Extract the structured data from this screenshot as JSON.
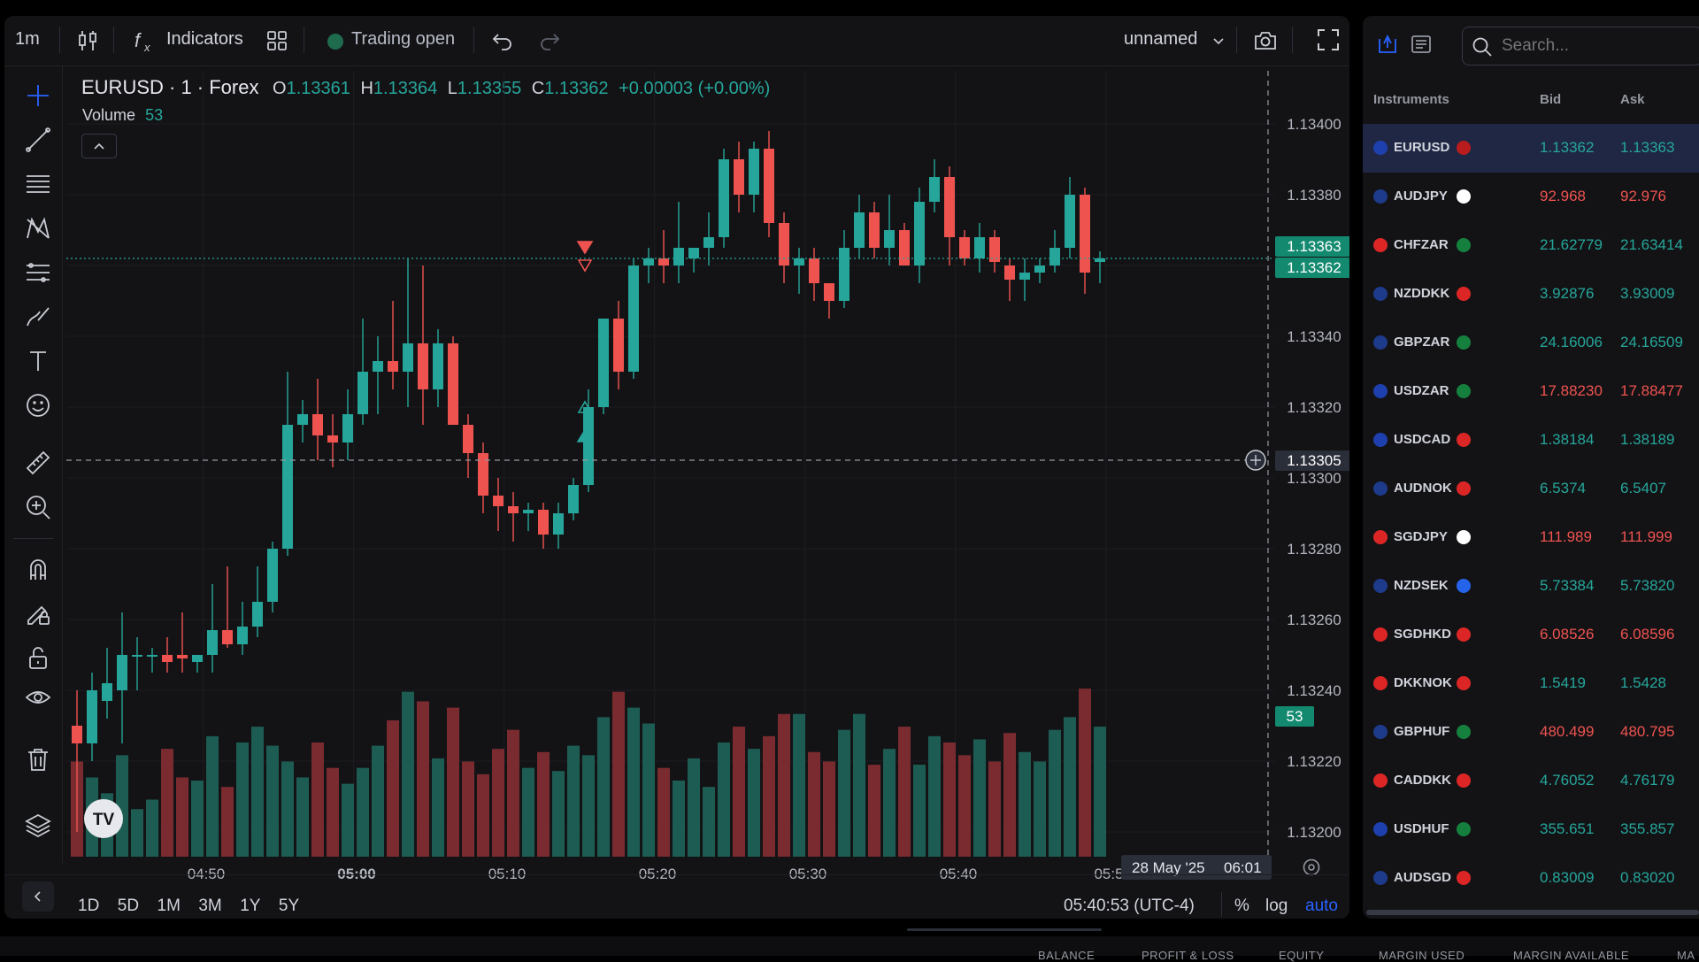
{
  "toolbar": {
    "interval": "1m",
    "indicators_label": "Indicators",
    "trading_status": "Trading open",
    "layout_name": "unnamed"
  },
  "legend": {
    "symbol": "EURUSD · 1 · Forex",
    "o_label": "O",
    "open": "1.13361",
    "h_label": "H",
    "high": "1.13364",
    "l_label": "L",
    "low": "1.13355",
    "c_label": "C",
    "close": "1.13362",
    "change": "+0.00003 (+0.00%)",
    "volume_label": "Volume",
    "volume_value": "53"
  },
  "price_axis": {
    "ticks": [
      "1.13400",
      "1.13380",
      "1.13340",
      "1.13320",
      "1.13300",
      "1.13280",
      "1.13260",
      "1.13240",
      "1.13220",
      "1.13200"
    ],
    "ask_tag": "1.13363",
    "bid_tag": "1.13362",
    "crosshair_price": "1.13305",
    "volume_tag": "53"
  },
  "time_axis": {
    "ticks": [
      "04:50",
      "05:00",
      "05:10",
      "05:20",
      "05:30",
      "05:40",
      "05:5"
    ],
    "crosshair_date": "28 May '25",
    "crosshair_time": "06:01"
  },
  "bottom_toolbar": {
    "ranges": [
      "1D",
      "5D",
      "1M",
      "3M",
      "1Y",
      "5Y"
    ],
    "clock": "05:40:53 (UTC-4)",
    "percent": "%",
    "log": "log",
    "auto": "auto"
  },
  "colors": {
    "up": "#26a69a",
    "down": "#ef5350",
    "vol_up": "#1d5c52",
    "vol_down": "#7a2b30",
    "accent": "#2962ff",
    "panel": "#131316"
  },
  "chart_data": {
    "type": "candlestick",
    "symbol": "EURUSD",
    "interval": "1m",
    "ylim": [
      1.132,
      1.13405
    ],
    "x_ticks": [
      "04:50",
      "05:00",
      "05:10",
      "05:20",
      "05:30",
      "05:40"
    ],
    "candles": [
      {
        "o": 1.1323,
        "h": 1.1324,
        "l": 1.132,
        "c": 1.13225,
        "v": 30
      },
      {
        "o": 1.13225,
        "h": 1.13245,
        "l": 1.1322,
        "c": 1.1324,
        "v": 25
      },
      {
        "o": 1.13237,
        "h": 1.13252,
        "l": 1.13232,
        "c": 1.13242,
        "v": 20
      },
      {
        "o": 1.1324,
        "h": 1.13262,
        "l": 1.13225,
        "c": 1.1325,
        "v": 32
      },
      {
        "o": 1.1325,
        "h": 1.13255,
        "l": 1.1324,
        "c": 1.1325,
        "v": 15
      },
      {
        "o": 1.1325,
        "h": 1.13252,
        "l": 1.13245,
        "c": 1.1325,
        "v": 18
      },
      {
        "o": 1.1325,
        "h": 1.13255,
        "l": 1.13245,
        "c": 1.13248,
        "v": 34
      },
      {
        "o": 1.1325,
        "h": 1.13262,
        "l": 1.13245,
        "c": 1.13249,
        "v": 25
      },
      {
        "o": 1.13248,
        "h": 1.1325,
        "l": 1.13245,
        "c": 1.1325,
        "v": 24
      },
      {
        "o": 1.1325,
        "h": 1.1327,
        "l": 1.13245,
        "c": 1.13257,
        "v": 38
      },
      {
        "o": 1.13257,
        "h": 1.13275,
        "l": 1.13252,
        "c": 1.13253,
        "v": 22
      },
      {
        "o": 1.13253,
        "h": 1.13265,
        "l": 1.1325,
        "c": 1.13258,
        "v": 36
      },
      {
        "o": 1.13258,
        "h": 1.13275,
        "l": 1.13255,
        "c": 1.13265,
        "v": 41
      },
      {
        "o": 1.13265,
        "h": 1.13282,
        "l": 1.13262,
        "c": 1.1328,
        "v": 35
      },
      {
        "o": 1.1328,
        "h": 1.1333,
        "l": 1.13278,
        "c": 1.13315,
        "v": 30
      },
      {
        "o": 1.13315,
        "h": 1.13322,
        "l": 1.1331,
        "c": 1.13318,
        "v": 25
      },
      {
        "o": 1.13318,
        "h": 1.13328,
        "l": 1.13305,
        "c": 1.13312,
        "v": 36
      },
      {
        "o": 1.13312,
        "h": 1.13318,
        "l": 1.13303,
        "c": 1.1331,
        "v": 28
      },
      {
        "o": 1.1331,
        "h": 1.13325,
        "l": 1.13305,
        "c": 1.13318,
        "v": 23
      },
      {
        "o": 1.13318,
        "h": 1.13345,
        "l": 1.13315,
        "c": 1.1333,
        "v": 28
      },
      {
        "o": 1.1333,
        "h": 1.1334,
        "l": 1.13318,
        "c": 1.13333,
        "v": 35
      },
      {
        "o": 1.13333,
        "h": 1.1335,
        "l": 1.13325,
        "c": 1.1333,
        "v": 43
      },
      {
        "o": 1.1333,
        "h": 1.13362,
        "l": 1.1332,
        "c": 1.13338,
        "v": 52
      },
      {
        "o": 1.13338,
        "h": 1.1336,
        "l": 1.13315,
        "c": 1.13325,
        "v": 49
      },
      {
        "o": 1.13325,
        "h": 1.13342,
        "l": 1.1332,
        "c": 1.13338,
        "v": 31
      },
      {
        "o": 1.13338,
        "h": 1.1334,
        "l": 1.13315,
        "c": 1.13315,
        "v": 47
      },
      {
        "o": 1.13315,
        "h": 1.13318,
        "l": 1.133,
        "c": 1.13307,
        "v": 30
      },
      {
        "o": 1.13307,
        "h": 1.1331,
        "l": 1.1329,
        "c": 1.13295,
        "v": 26
      },
      {
        "o": 1.13295,
        "h": 1.133,
        "l": 1.13285,
        "c": 1.13292,
        "v": 34
      },
      {
        "o": 1.13292,
        "h": 1.13296,
        "l": 1.13282,
        "c": 1.1329,
        "v": 40
      },
      {
        "o": 1.1329,
        "h": 1.13293,
        "l": 1.13285,
        "c": 1.13291,
        "v": 28
      },
      {
        "o": 1.13291,
        "h": 1.13293,
        "l": 1.1328,
        "c": 1.13284,
        "v": 33
      },
      {
        "o": 1.13284,
        "h": 1.13293,
        "l": 1.1328,
        "c": 1.1329,
        "v": 27
      },
      {
        "o": 1.1329,
        "h": 1.133,
        "l": 1.13288,
        "c": 1.13298,
        "v": 35
      },
      {
        "o": 1.13298,
        "h": 1.13325,
        "l": 1.13296,
        "c": 1.1332,
        "v": 32
      },
      {
        "o": 1.1332,
        "h": 1.13345,
        "l": 1.13318,
        "c": 1.13345,
        "v": 44
      },
      {
        "o": 1.13345,
        "h": 1.1335,
        "l": 1.13325,
        "c": 1.1333,
        "v": 52
      },
      {
        "o": 1.1333,
        "h": 1.13362,
        "l": 1.13328,
        "c": 1.1336,
        "v": 47
      },
      {
        "o": 1.1336,
        "h": 1.13365,
        "l": 1.13355,
        "c": 1.13362,
        "v": 42
      },
      {
        "o": 1.13362,
        "h": 1.1337,
        "l": 1.13355,
        "c": 1.1336,
        "v": 28
      },
      {
        "o": 1.1336,
        "h": 1.13378,
        "l": 1.13355,
        "c": 1.13365,
        "v": 24
      },
      {
        "o": 1.13362,
        "h": 1.13365,
        "l": 1.13358,
        "c": 1.13365,
        "v": 31
      },
      {
        "o": 1.13365,
        "h": 1.13375,
        "l": 1.1336,
        "c": 1.13368,
        "v": 22
      },
      {
        "o": 1.13368,
        "h": 1.13393,
        "l": 1.13365,
        "c": 1.1339,
        "v": 36
      },
      {
        "o": 1.1339,
        "h": 1.13395,
        "l": 1.13375,
        "c": 1.1338,
        "v": 41
      },
      {
        "o": 1.1338,
        "h": 1.13395,
        "l": 1.13375,
        "c": 1.13393,
        "v": 34
      },
      {
        "o": 1.13393,
        "h": 1.13398,
        "l": 1.13368,
        "c": 1.13372,
        "v": 38
      },
      {
        "o": 1.13372,
        "h": 1.13375,
        "l": 1.13355,
        "c": 1.1336,
        "v": 45
      },
      {
        "o": 1.1336,
        "h": 1.13365,
        "l": 1.13352,
        "c": 1.13362,
        "v": 45
      },
      {
        "o": 1.13362,
        "h": 1.13365,
        "l": 1.1335,
        "c": 1.13355,
        "v": 33
      },
      {
        "o": 1.13355,
        "h": 1.13355,
        "l": 1.13345,
        "c": 1.1335,
        "v": 30
      },
      {
        "o": 1.1335,
        "h": 1.1337,
        "l": 1.13348,
        "c": 1.13365,
        "v": 40
      },
      {
        "o": 1.13365,
        "h": 1.1338,
        "l": 1.13362,
        "c": 1.13375,
        "v": 45
      },
      {
        "o": 1.13375,
        "h": 1.13378,
        "l": 1.13362,
        "c": 1.13365,
        "v": 29
      },
      {
        "o": 1.13365,
        "h": 1.1338,
        "l": 1.1336,
        "c": 1.1337,
        "v": 34
      },
      {
        "o": 1.1337,
        "h": 1.13372,
        "l": 1.1336,
        "c": 1.1336,
        "v": 41
      },
      {
        "o": 1.1336,
        "h": 1.13382,
        "l": 1.13355,
        "c": 1.13378,
        "v": 29
      },
      {
        "o": 1.13378,
        "h": 1.1339,
        "l": 1.13375,
        "c": 1.13385,
        "v": 38
      },
      {
        "o": 1.13385,
        "h": 1.13388,
        "l": 1.1336,
        "c": 1.13368,
        "v": 36
      },
      {
        "o": 1.13368,
        "h": 1.1337,
        "l": 1.1336,
        "c": 1.13362,
        "v": 32
      },
      {
        "o": 1.13362,
        "h": 1.13372,
        "l": 1.13358,
        "c": 1.13368,
        "v": 37
      },
      {
        "o": 1.13368,
        "h": 1.1337,
        "l": 1.13358,
        "c": 1.13361,
        "v": 30
      },
      {
        "o": 1.1336,
        "h": 1.13362,
        "l": 1.1335,
        "c": 1.13356,
        "v": 39
      },
      {
        "o": 1.13356,
        "h": 1.13362,
        "l": 1.1335,
        "c": 1.13358,
        "v": 33
      },
      {
        "o": 1.13358,
        "h": 1.13362,
        "l": 1.13355,
        "c": 1.1336,
        "v": 30
      },
      {
        "o": 1.1336,
        "h": 1.1337,
        "l": 1.13358,
        "c": 1.13365,
        "v": 40
      },
      {
        "o": 1.13365,
        "h": 1.13385,
        "l": 1.13362,
        "c": 1.1338,
        "v": 44
      },
      {
        "o": 1.1338,
        "h": 1.13382,
        "l": 1.13352,
        "c": 1.13358,
        "v": 53
      },
      {
        "o": 1.13361,
        "h": 1.13364,
        "l": 1.13355,
        "c": 1.13362,
        "v": 41
      }
    ],
    "trade_markers": [
      {
        "index": 34,
        "price": 1.13365,
        "type": "sell"
      },
      {
        "index": 34,
        "price": 1.1336,
        "type": "sell-outline"
      },
      {
        "index": 34,
        "price": 1.1332,
        "type": "buy-outline"
      },
      {
        "index": 34,
        "price": 1.13312,
        "type": "buy"
      }
    ]
  },
  "instruments": {
    "header": {
      "col1": "Instruments",
      "col2": "Bid",
      "col3": "Ask"
    },
    "search_placeholder": "Search...",
    "rows": [
      {
        "symbol": "EURUSD",
        "bid": "1.13362",
        "ask": "1.13363",
        "dir": "up",
        "f1": "#1e40af",
        "f2": "#b91c1c",
        "selected": true
      },
      {
        "symbol": "AUDJPY",
        "bid": "92.968",
        "ask": "92.976",
        "dir": "down",
        "f1": "#1e3a8a",
        "f2": "#ffffff"
      },
      {
        "symbol": "CHFZAR",
        "bid": "21.62779",
        "ask": "21.63414",
        "dir": "up",
        "f1": "#dc2626",
        "f2": "#15803d"
      },
      {
        "symbol": "NZDDKK",
        "bid": "3.92876",
        "ask": "3.93009",
        "dir": "up",
        "f1": "#1e3a8a",
        "f2": "#dc2626"
      },
      {
        "symbol": "GBPZAR",
        "bid": "24.16006",
        "ask": "24.16509",
        "dir": "up",
        "f1": "#1e3a8a",
        "f2": "#15803d"
      },
      {
        "symbol": "USDZAR",
        "bid": "17.88230",
        "ask": "17.88477",
        "dir": "down",
        "f1": "#1e40af",
        "f2": "#15803d"
      },
      {
        "symbol": "USDCAD",
        "bid": "1.38184",
        "ask": "1.38189",
        "dir": "up",
        "f1": "#1e40af",
        "f2": "#dc2626"
      },
      {
        "symbol": "AUDNOK",
        "bid": "6.5374",
        "ask": "6.5407",
        "dir": "up",
        "f1": "#1e3a8a",
        "f2": "#dc2626"
      },
      {
        "symbol": "SGDJPY",
        "bid": "111.989",
        "ask": "111.999",
        "dir": "down",
        "f1": "#dc2626",
        "f2": "#ffffff"
      },
      {
        "symbol": "NZDSEK",
        "bid": "5.73384",
        "ask": "5.73820",
        "dir": "up",
        "f1": "#1e3a8a",
        "f2": "#2563eb"
      },
      {
        "symbol": "SGDHKD",
        "bid": "6.08526",
        "ask": "6.08596",
        "dir": "down",
        "f1": "#dc2626",
        "f2": "#dc2626"
      },
      {
        "symbol": "DKKNOK",
        "bid": "1.5419",
        "ask": "1.5428",
        "dir": "up",
        "f1": "#dc2626",
        "f2": "#dc2626"
      },
      {
        "symbol": "GBPHUF",
        "bid": "480.499",
        "ask": "480.795",
        "dir": "down",
        "f1": "#1e3a8a",
        "f2": "#15803d"
      },
      {
        "symbol": "CADDKK",
        "bid": "4.76052",
        "ask": "4.76179",
        "dir": "up",
        "f1": "#dc2626",
        "f2": "#dc2626"
      },
      {
        "symbol": "USDHUF",
        "bid": "355.651",
        "ask": "355.857",
        "dir": "up",
        "f1": "#1e40af",
        "f2": "#15803d"
      },
      {
        "symbol": "AUDSGD",
        "bid": "0.83009",
        "ask": "0.83020",
        "dir": "up",
        "f1": "#1e3a8a",
        "f2": "#dc2626"
      }
    ]
  },
  "account_bar": {
    "labels": [
      "BALANCE",
      "PROFIT & LOSS",
      "EQUITY",
      "MARGIN USED",
      "MARGIN AVAILABLE",
      "MA"
    ]
  }
}
